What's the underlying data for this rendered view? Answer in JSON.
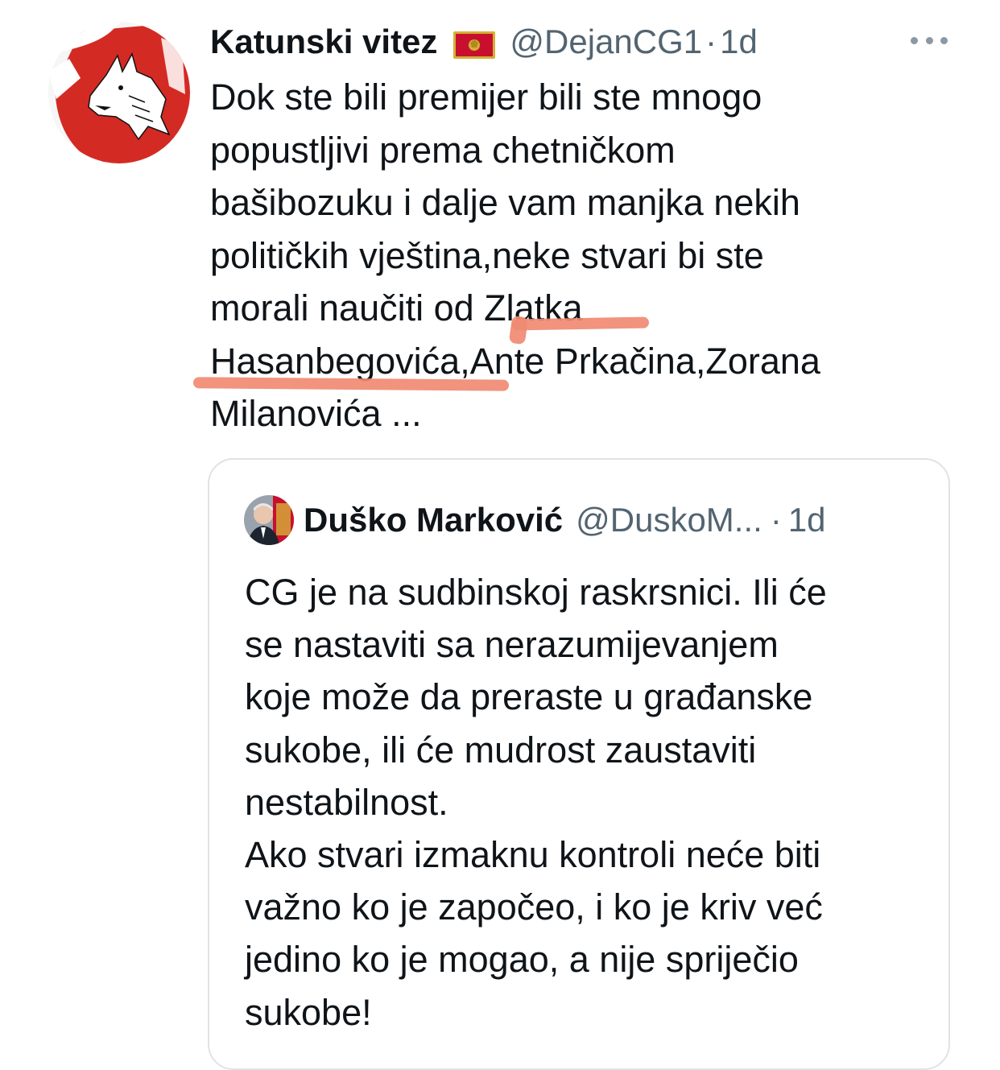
{
  "tweet": {
    "author": {
      "name": "Katunski vitez",
      "handle": "@DejanCG1",
      "separator": "·",
      "time": "1d"
    },
    "text_lines": [
      "Dok ste bili premijer bili ste mnogo",
      "popustljivi prema chetničkom",
      "bašibozuku i dalje vam manjka nekih",
      "političkih vještina,neke stvari bi ste",
      "morali naučiti od Zlatka",
      "Hasanbegovića,Ante Prkačina,Zorana",
      "Milanovića ..."
    ]
  },
  "quoted_tweet": {
    "author": {
      "name": "Duško Marković",
      "handle": "@DuskoM...",
      "separator": "·",
      "time": "1d"
    },
    "text_lines": [
      "CG je na sudbinskoj raskrsnici. Ili će",
      "se nastaviti sa nerazumijevanjem",
      "koje može da preraste u građanske",
      "sukobe, ili će mudrost zaustaviti",
      "nestabilnost.",
      "Ako stvari izmaknu kontroli neće biti",
      "važno ko je započeo, i ko je kriv već",
      "jedino ko je mogao, a nije spriječio",
      "sukobe!"
    ]
  },
  "icons": {
    "avatar": "wolf-head-emblem",
    "flag": "montenegro-flag",
    "more": "more-options-icon"
  },
  "colors": {
    "text": "#0f1419",
    "secondary_text": "#536471",
    "card_border": "#dfe3e7",
    "highlight_underline": "#f08a72",
    "avatar_red": "#d42a24"
  }
}
